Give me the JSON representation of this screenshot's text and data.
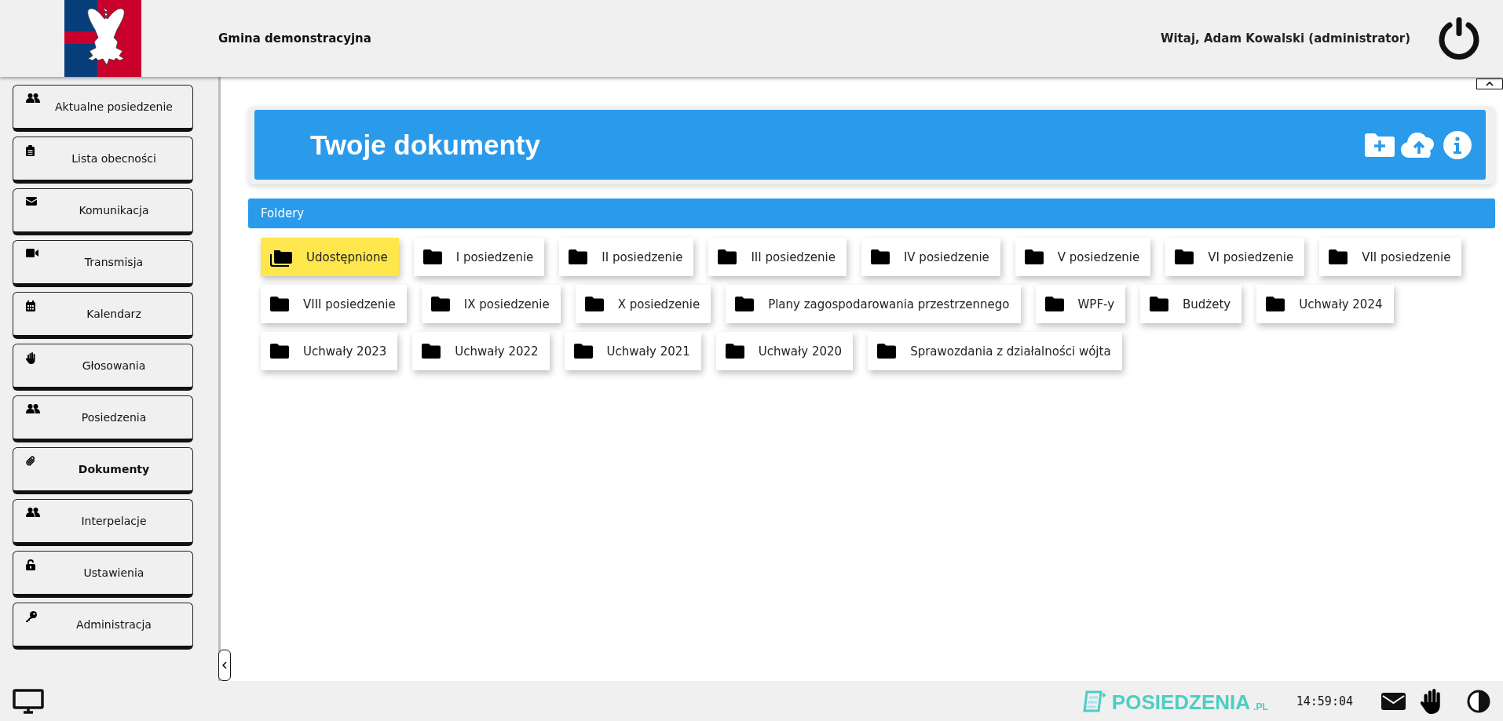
{
  "header": {
    "municipality": "Gmina demonstracyjna",
    "greeting": "Witaj, Adam Kowalski (administrator)"
  },
  "sidebar": {
    "items": [
      {
        "label": "Aktualne posiedzenie",
        "selected": false
      },
      {
        "label": "Lista obecności",
        "selected": false
      },
      {
        "label": "Komunikacja",
        "selected": false
      },
      {
        "label": "Transmisja",
        "selected": false
      },
      {
        "label": "Kalendarz",
        "selected": false
      },
      {
        "label": "Głosowania",
        "selected": false
      },
      {
        "label": "Posiedzenia",
        "selected": false
      },
      {
        "label": "Dokumenty",
        "selected": true
      },
      {
        "label": "Interpelacje",
        "selected": false
      },
      {
        "label": "Ustawienia",
        "selected": false
      },
      {
        "label": "Administracja",
        "selected": false
      }
    ]
  },
  "page": {
    "title": "Twoje dokumenty"
  },
  "folders": {
    "heading": "Foldery",
    "items": [
      {
        "label": "Udostępnione",
        "kind": "shared",
        "selected": true
      },
      {
        "label": "I posiedzenie",
        "kind": "folder",
        "selected": false
      },
      {
        "label": "II posiedzenie",
        "kind": "folder",
        "selected": false
      },
      {
        "label": "III posiedzenie",
        "kind": "folder",
        "selected": false
      },
      {
        "label": "IV posiedzenie",
        "kind": "folder",
        "selected": false
      },
      {
        "label": "V posiedzenie",
        "kind": "folder",
        "selected": false
      },
      {
        "label": "VI posiedzenie",
        "kind": "folder",
        "selected": false
      },
      {
        "label": "VII posiedzenie",
        "kind": "folder",
        "selected": false
      },
      {
        "label": "VIII posiedzenie",
        "kind": "folder",
        "selected": false
      },
      {
        "label": "IX posiedzenie",
        "kind": "folder",
        "selected": false
      },
      {
        "label": "X posiedzenie",
        "kind": "folder",
        "selected": false
      },
      {
        "label": "Plany zagospodarowania przestrzennego",
        "kind": "folder",
        "selected": false
      },
      {
        "label": "WPF-y",
        "kind": "folder",
        "selected": false
      },
      {
        "label": "Budżety",
        "kind": "folder",
        "selected": false
      },
      {
        "label": "Uchwały 2024",
        "kind": "folder",
        "selected": false
      },
      {
        "label": "Uchwały 2023",
        "kind": "folder",
        "selected": false
      },
      {
        "label": "Uchwały 2022",
        "kind": "folder",
        "selected": false
      },
      {
        "label": "Uchwały 2021",
        "kind": "folder",
        "selected": false
      },
      {
        "label": "Uchwały 2020",
        "kind": "folder",
        "selected": false
      },
      {
        "label": "Sprawozdania z działalności wójta",
        "kind": "folder",
        "selected": false
      }
    ]
  },
  "footer": {
    "brand": "POSIEDZENIA",
    "brand_suffix": ".PL",
    "time": "14:59:04"
  }
}
